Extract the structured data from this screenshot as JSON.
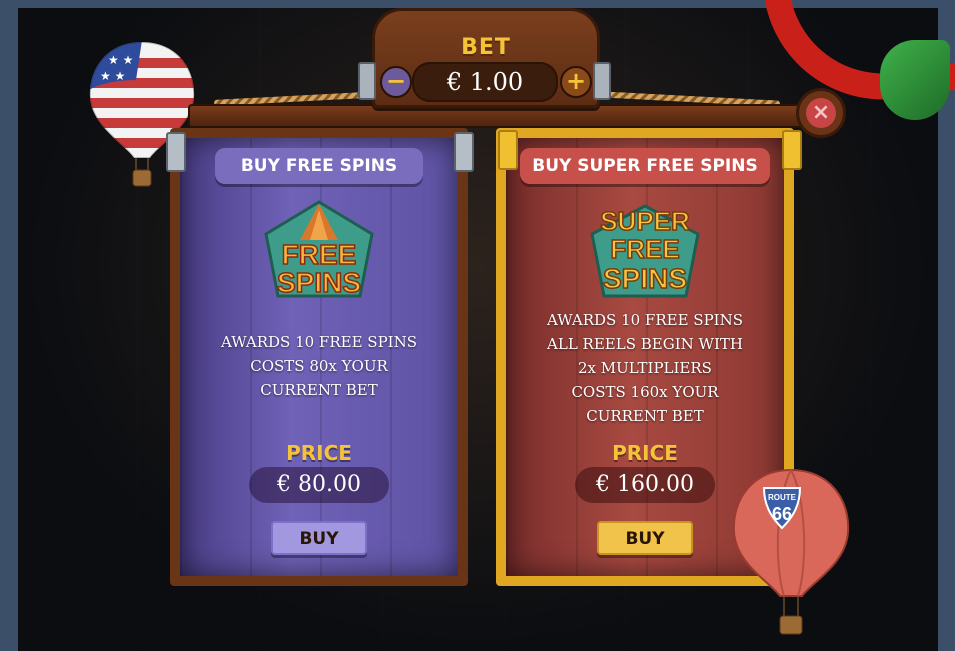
{
  "bet": {
    "label": "BET",
    "value": "€ 1.00",
    "minus_symbol": "−",
    "plus_symbol": "+"
  },
  "close": {
    "symbol": "×"
  },
  "offers": [
    {
      "title": "BUY FREE SPINS",
      "emblem_lines": [
        "FREE",
        "SPINS"
      ],
      "description_lines": [
        "AWARDS 10 FREE SPINS",
        "COSTS 80x YOUR",
        "CURRENT BET"
      ],
      "price_label": "PRICE",
      "price": "€ 80.00",
      "buy_label": "BUY"
    },
    {
      "title": "BUY SUPER FREE SPINS",
      "emblem_lines": [
        "SUPER",
        "FREE",
        "SPINS"
      ],
      "description_lines": [
        "AWARDS 10 FREE SPINS",
        "ALL REELS BEGIN WITH",
        "2x MULTIPLIERS",
        "COSTS 160x YOUR",
        "CURRENT BET"
      ],
      "price_label": "PRICE",
      "price": "€ 160.00",
      "buy_label": "BUY"
    }
  ],
  "balloon_badge": {
    "top": "ROUTE",
    "number": "66"
  },
  "colors": {
    "gold": "#f4c33a",
    "left_panel": "#6f62b7",
    "right_panel": "#a84a41",
    "wood": "#6a3517"
  }
}
